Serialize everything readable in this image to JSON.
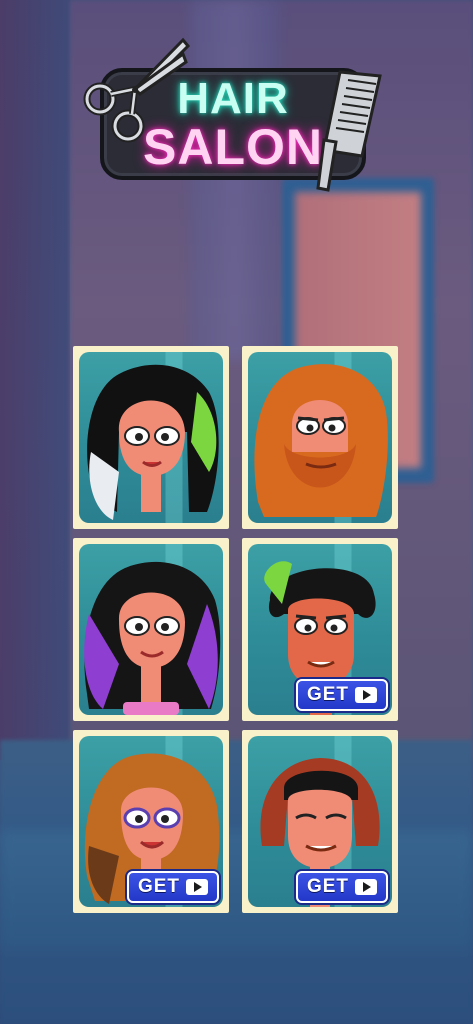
{
  "logo": {
    "line1": "HAIR",
    "line2": "SALON"
  },
  "characters": [
    {
      "id": "curly-white-green",
      "locked": false
    },
    {
      "id": "red-beard-man",
      "locked": false
    },
    {
      "id": "purple-curls",
      "locked": false
    },
    {
      "id": "green-afro-man",
      "locked": true,
      "button_label": "GET"
    },
    {
      "id": "orange-curls",
      "locked": true,
      "button_label": "GET"
    },
    {
      "id": "red-bob",
      "locked": true,
      "button_label": "GET"
    }
  ],
  "colors": {
    "card_border": "#f8f1c9",
    "card_bg": "#2e8c98",
    "get_button": "#2338c8",
    "neon_teal": "#24e3c2",
    "neon_pink": "#ff2ec1"
  }
}
